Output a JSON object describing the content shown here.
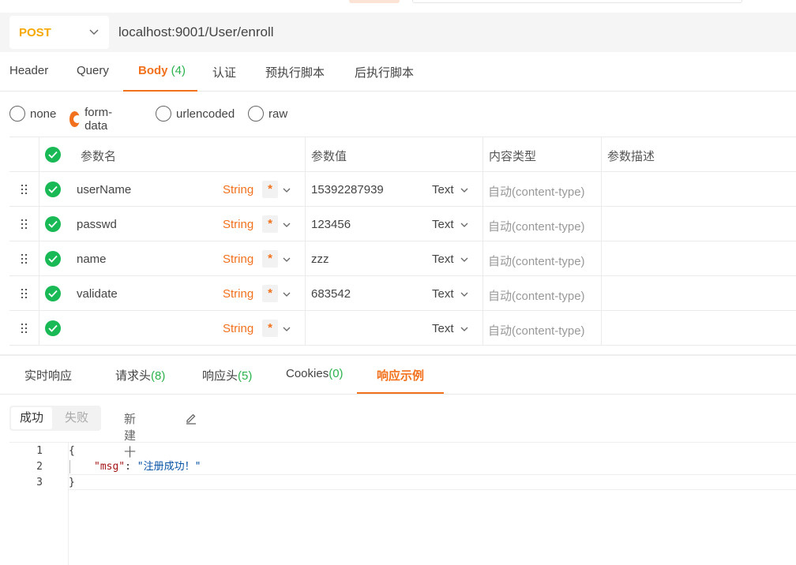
{
  "request": {
    "method": "POST",
    "url": "localhost:9001/User/enroll"
  },
  "request_tabs": [
    {
      "label": "Header",
      "count": ""
    },
    {
      "label": "Query",
      "count": ""
    },
    {
      "label": "Body",
      "count": "(4)"
    },
    {
      "label": "认证",
      "count": ""
    },
    {
      "label": "预执行脚本",
      "count": ""
    },
    {
      "label": "后执行脚本",
      "count": ""
    }
  ],
  "body_types": [
    "none",
    "form-data",
    "urlencoded",
    "raw"
  ],
  "body_type_selected": "form-data",
  "params_table": {
    "headers": {
      "name": "参数名",
      "value": "参数值",
      "content_type": "内容类型",
      "description": "参数描述"
    },
    "rows": [
      {
        "name": "userName",
        "type": "String",
        "required": "*",
        "value": "15392287939",
        "value_type": "Text",
        "content_type": "自动(content-type)",
        "description": ""
      },
      {
        "name": "passwd",
        "type": "String",
        "required": "*",
        "value": "123456",
        "value_type": "Text",
        "content_type": "自动(content-type)",
        "description": ""
      },
      {
        "name": "name",
        "type": "String",
        "required": "*",
        "value": "zzz",
        "value_type": "Text",
        "content_type": "自动(content-type)",
        "description": ""
      },
      {
        "name": "validate",
        "type": "String",
        "required": "*",
        "value": "683542",
        "value_type": "Text",
        "content_type": "自动(content-type)",
        "description": ""
      },
      {
        "name": "",
        "type": "String",
        "required": "*",
        "value": "",
        "value_type": "Text",
        "content_type": "自动(content-type)",
        "description": ""
      }
    ]
  },
  "response_tabs": [
    {
      "label": "实时响应",
      "count": ""
    },
    {
      "label": "请求头",
      "count": "(8)"
    },
    {
      "label": "响应头",
      "count": "(5)"
    },
    {
      "label": "Cookies",
      "count": "(0)"
    },
    {
      "label": "响应示例",
      "count": ""
    }
  ],
  "example_toolbar": {
    "success_label": "成功",
    "fail_label": "失败",
    "new_label": "新建十"
  },
  "code": {
    "line_numbers": [
      "1",
      "2",
      "3"
    ],
    "open_brace": "{",
    "key": "\"msg\"",
    "colon": ": ",
    "value": "\"注册成功！\"",
    "close_brace": "}"
  },
  "colors": {
    "accent": "#f2711c",
    "method": "#f6a800",
    "count_green": "#2bb24c",
    "check_green": "#19b955"
  }
}
